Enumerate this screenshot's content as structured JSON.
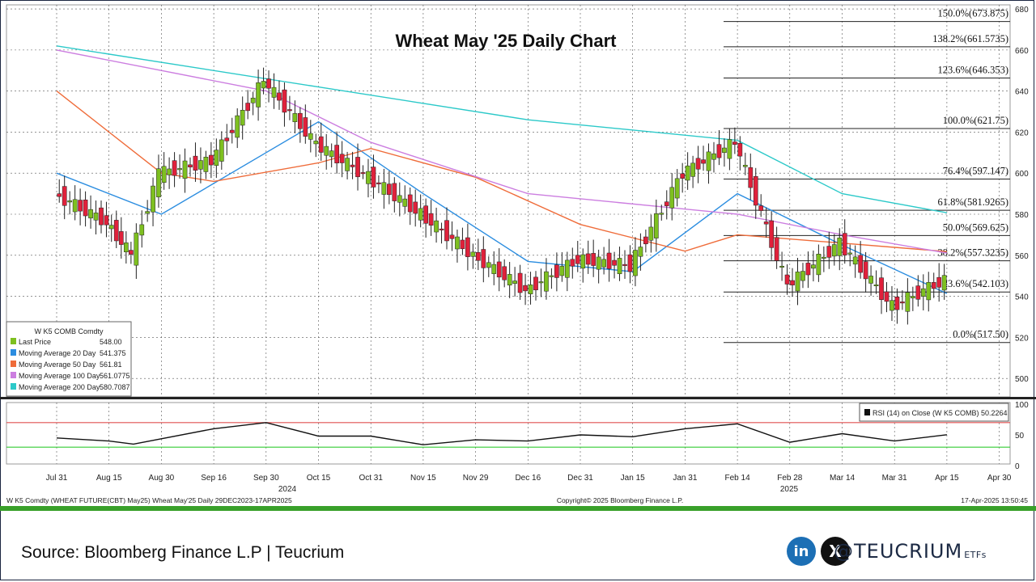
{
  "chart_data": {
    "type": "candlestick",
    "title": "Wheat May '25 Daily Chart",
    "y_ticks": [
      500,
      520,
      540,
      560,
      580,
      600,
      620,
      640,
      660,
      680
    ],
    "ylim": [
      491,
      682
    ],
    "x_labels": [
      "Jul 31",
      "Aug 15",
      "Aug 30",
      "Sep 16",
      "Sep 30",
      "Oct 15",
      "Oct 31",
      "Nov 15",
      "Nov 29",
      "Dec 16",
      "Dec 31",
      "Jan 15",
      "Jan 31",
      "Feb 14",
      "Feb 28",
      "Mar 14",
      "Mar 31",
      "Apr 15",
      "Apr 30"
    ],
    "year_labels": [
      "2024",
      "2025"
    ],
    "close_points": [
      {
        "date": "Jul 31",
        "close": 590
      },
      {
        "date": "Aug 15",
        "close": 576
      },
      {
        "date": "Aug 22",
        "close": 560
      },
      {
        "date": "Aug 30",
        "close": 600
      },
      {
        "date": "Sep 16",
        "close": 606
      },
      {
        "date": "Sep 30",
        "close": 645
      },
      {
        "date": "Oct 15",
        "close": 614
      },
      {
        "date": "Oct 31",
        "close": 598
      },
      {
        "date": "Nov 15",
        "close": 580
      },
      {
        "date": "Nov 29",
        "close": 560
      },
      {
        "date": "Dec 16",
        "close": 543
      },
      {
        "date": "Dec 31",
        "close": 558
      },
      {
        "date": "Jan 15",
        "close": 555
      },
      {
        "date": "Jan 31",
        "close": 600
      },
      {
        "date": "Feb 14",
        "close": 615
      },
      {
        "date": "Feb 28",
        "close": 545
      },
      {
        "date": "Mar 14",
        "close": 566
      },
      {
        "date": "Mar 31",
        "close": 535
      },
      {
        "date": "Apr 15",
        "close": 548
      }
    ],
    "moving_averages": [
      {
        "name": "Moving Average 20 Day",
        "color": "#2b8de0",
        "points": [
          {
            "date": "Jul 31",
            "v": 600
          },
          {
            "date": "Aug 30",
            "v": 580
          },
          {
            "date": "Sep 30",
            "v": 610
          },
          {
            "date": "Oct 15",
            "v": 625
          },
          {
            "date": "Nov 15",
            "v": 590
          },
          {
            "date": "Dec 16",
            "v": 557
          },
          {
            "date": "Jan 15",
            "v": 552
          },
          {
            "date": "Feb 14",
            "v": 590
          },
          {
            "date": "Mar 14",
            "v": 565
          },
          {
            "date": "Apr 15",
            "v": 541.375
          }
        ]
      },
      {
        "name": "Moving Average 50 Day",
        "color": "#ef6c3a",
        "points": [
          {
            "date": "Jul 31",
            "v": 640
          },
          {
            "date": "Aug 30",
            "v": 600
          },
          {
            "date": "Sep 16",
            "v": 596
          },
          {
            "date": "Oct 15",
            "v": 605
          },
          {
            "date": "Oct 31",
            "v": 612
          },
          {
            "date": "Nov 29",
            "v": 598
          },
          {
            "date": "Dec 31",
            "v": 575
          },
          {
            "date": "Jan 31",
            "v": 562
          },
          {
            "date": "Feb 14",
            "v": 570
          },
          {
            "date": "Apr 15",
            "v": 561.81
          }
        ]
      },
      {
        "name": "Moving Average 100 Day",
        "color": "#cc7ee0",
        "points": [
          {
            "date": "Jul 31",
            "v": 660
          },
          {
            "date": "Sep 30",
            "v": 640
          },
          {
            "date": "Oct 31",
            "v": 615
          },
          {
            "date": "Dec 16",
            "v": 590
          },
          {
            "date": "Feb 14",
            "v": 580
          },
          {
            "date": "Mar 14",
            "v": 570
          },
          {
            "date": "Apr 15",
            "v": 561.0775
          }
        ]
      },
      {
        "name": "Moving Average 200 Day",
        "color": "#2cc9c9",
        "points": [
          {
            "date": "Jul 31",
            "v": 662
          },
          {
            "date": "Oct 15",
            "v": 642
          },
          {
            "date": "Dec 16",
            "v": 626
          },
          {
            "date": "Feb 14",
            "v": 616
          },
          {
            "date": "Mar 14",
            "v": 590
          },
          {
            "date": "Apr 15",
            "v": 580.7087
          }
        ]
      }
    ],
    "fib_levels": [
      {
        "label": "150.0%(673.875)",
        "value": 673.875
      },
      {
        "label": "138.2%(661.5735)",
        "value": 661.5735
      },
      {
        "label": "123.6%(646.353)",
        "value": 646.353
      },
      {
        "label": "100.0%(621.75)",
        "value": 621.75
      },
      {
        "label": "76.4%(597.147)",
        "value": 597.147
      },
      {
        "label": "61.8%(581.9265)",
        "value": 581.9265
      },
      {
        "label": "50.0%(569.625)",
        "value": 569.625
      },
      {
        "label": "38.2%(557.3235)",
        "value": 557.3235
      },
      {
        "label": "23.6%(542.103)",
        "value": 542.103
      },
      {
        "label": "0.0%(517.50)",
        "value": 517.5
      }
    ],
    "legend": {
      "header": "W K5 COMB Comdty",
      "items": [
        {
          "label": "Last Price",
          "value": "548.00",
          "color": "#7ec020"
        },
        {
          "label": "Moving Average 20 Day",
          "value": "541.375",
          "color": "#2b8de0"
        },
        {
          "label": "Moving Average 50 Day",
          "value": "561.81",
          "color": "#ef6c3a"
        },
        {
          "label": "Moving Average 100 Day",
          "value": "561.0775",
          "color": "#cc7ee0"
        },
        {
          "label": "Moving Average 200 Day",
          "value": "580.7087",
          "color": "#2cc9c9"
        }
      ]
    },
    "rsi": {
      "label": "RSI (14)  on Close (W K5 COMB) 50.2264",
      "ticks": [
        100,
        50,
        0
      ],
      "overbought": 70,
      "oversold": 30,
      "points": [
        {
          "date": "Jul 31",
          "v": 45
        },
        {
          "date": "Aug 15",
          "v": 40
        },
        {
          "date": "Aug 22",
          "v": 35
        },
        {
          "date": "Sep 16",
          "v": 60
        },
        {
          "date": "Sep 30",
          "v": 70
        },
        {
          "date": "Oct 15",
          "v": 48
        },
        {
          "date": "Oct 31",
          "v": 48
        },
        {
          "date": "Nov 15",
          "v": 34
        },
        {
          "date": "Nov 29",
          "v": 42
        },
        {
          "date": "Dec 16",
          "v": 40
        },
        {
          "date": "Dec 31",
          "v": 50
        },
        {
          "date": "Jan 15",
          "v": 47
        },
        {
          "date": "Jan 31",
          "v": 60
        },
        {
          "date": "Feb 14",
          "v": 68
        },
        {
          "date": "Feb 28",
          "v": 38
        },
        {
          "date": "Mar 14",
          "v": 52
        },
        {
          "date": "Mar 31",
          "v": 40
        },
        {
          "date": "Apr 15",
          "v": 50.2264
        }
      ]
    }
  },
  "info": {
    "left": "W K5 Comdty (WHEAT FUTURE(CBT) May25) Wheat May'25  Daily 29DEC2023-17APR2025",
    "center": "Copyright© 2025 Bloomberg Finance L.P.",
    "right": "17-Apr-2025 13:50:45"
  },
  "footer": {
    "source": "Source: Bloomberg Finance L.P | Teucrium",
    "brand": "@TEUCRIUM",
    "brand_suffix": "ETFs",
    "linkedin_icon": "in",
    "x_icon": "X"
  },
  "colors": {
    "up": "#7ec020",
    "down": "#e0213b",
    "overbought": "#e05050",
    "oversold": "#33cc33",
    "frame": "#1a2540",
    "footer_band": "#39a02a"
  }
}
